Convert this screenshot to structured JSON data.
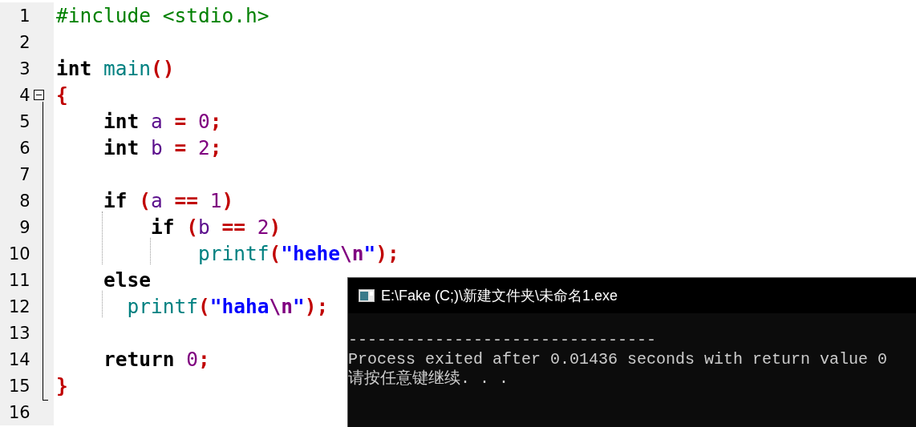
{
  "editor": {
    "lines": [
      {
        "number": "1",
        "tokens": [
          {
            "kind": "directive",
            "text": "#include <stdio.h>"
          }
        ]
      },
      {
        "number": "2"
      },
      {
        "number": "3",
        "tokens": [
          {
            "kind": "keyword",
            "text": "int"
          },
          {
            "kind": "function",
            "text": " main"
          },
          {
            "kind": "punct",
            "text": "()"
          }
        ]
      },
      {
        "number": "4",
        "fold": {
          "expanded": true
        },
        "tokens": [
          {
            "kind": "punct",
            "text": "{"
          }
        ]
      },
      {
        "number": "5",
        "tokens": [
          {
            "kind": "keyword",
            "text": "    int"
          },
          {
            "kind": "ident",
            "text": " a"
          },
          {
            "kind": "punct",
            "text": " ="
          },
          {
            "kind": "number",
            "text": " 0"
          },
          {
            "kind": "punct",
            "text": ";"
          }
        ]
      },
      {
        "number": "6",
        "tokens": [
          {
            "kind": "keyword",
            "text": "    int"
          },
          {
            "kind": "ident",
            "text": " b"
          },
          {
            "kind": "punct",
            "text": " ="
          },
          {
            "kind": "number",
            "text": " 2"
          },
          {
            "kind": "punct",
            "text": ";"
          }
        ]
      },
      {
        "number": "7"
      },
      {
        "number": "8",
        "tokens": [
          {
            "kind": "keyword",
            "text": "    if"
          },
          {
            "kind": "punct",
            "text": " ("
          },
          {
            "kind": "ident",
            "text": "a"
          },
          {
            "kind": "punct",
            "text": " =="
          },
          {
            "kind": "number",
            "text": " 1"
          },
          {
            "kind": "punct",
            "text": ")"
          }
        ]
      },
      {
        "number": "9",
        "tokens": [
          {
            "kind": "keyword",
            "text": "        if"
          },
          {
            "kind": "punct",
            "text": " ("
          },
          {
            "kind": "ident",
            "text": "b"
          },
          {
            "kind": "punct",
            "text": " =="
          },
          {
            "kind": "number",
            "text": " 2"
          },
          {
            "kind": "punct",
            "text": ")"
          }
        ]
      },
      {
        "number": "10",
        "tokens": [
          {
            "kind": "function",
            "text": "            printf"
          },
          {
            "kind": "punct",
            "text": "("
          },
          {
            "kind": "string",
            "text": "\"hehe"
          },
          {
            "kind": "escape",
            "text": "\\n"
          },
          {
            "kind": "string",
            "text": "\""
          },
          {
            "kind": "punct",
            "text": ");"
          }
        ]
      },
      {
        "number": "11",
        "tokens": [
          {
            "kind": "keyword",
            "text": "    else"
          }
        ]
      },
      {
        "number": "12",
        "tokens": [
          {
            "kind": "function",
            "text": "      printf"
          },
          {
            "kind": "punct",
            "text": "("
          },
          {
            "kind": "string",
            "text": "\"haha"
          },
          {
            "kind": "escape",
            "text": "\\n"
          },
          {
            "kind": "string",
            "text": "\""
          },
          {
            "kind": "punct",
            "text": ");"
          }
        ]
      },
      {
        "number": "13"
      },
      {
        "number": "14",
        "tokens": [
          {
            "kind": "keyword",
            "text": "    return"
          },
          {
            "kind": "number",
            "text": " 0"
          },
          {
            "kind": "punct",
            "text": ";"
          }
        ]
      },
      {
        "number": "15",
        "tokens": [
          {
            "kind": "punct",
            "text": "}"
          }
        ]
      },
      {
        "number": "16"
      }
    ]
  },
  "console": {
    "title": "E:\\Fake (C;)\\新建文件夹\\未命名1.exe",
    "lines": [
      "--------------------------------",
      "Process exited after 0.01436 seconds with return value 0",
      "请按任意键继续. . ."
    ]
  }
}
